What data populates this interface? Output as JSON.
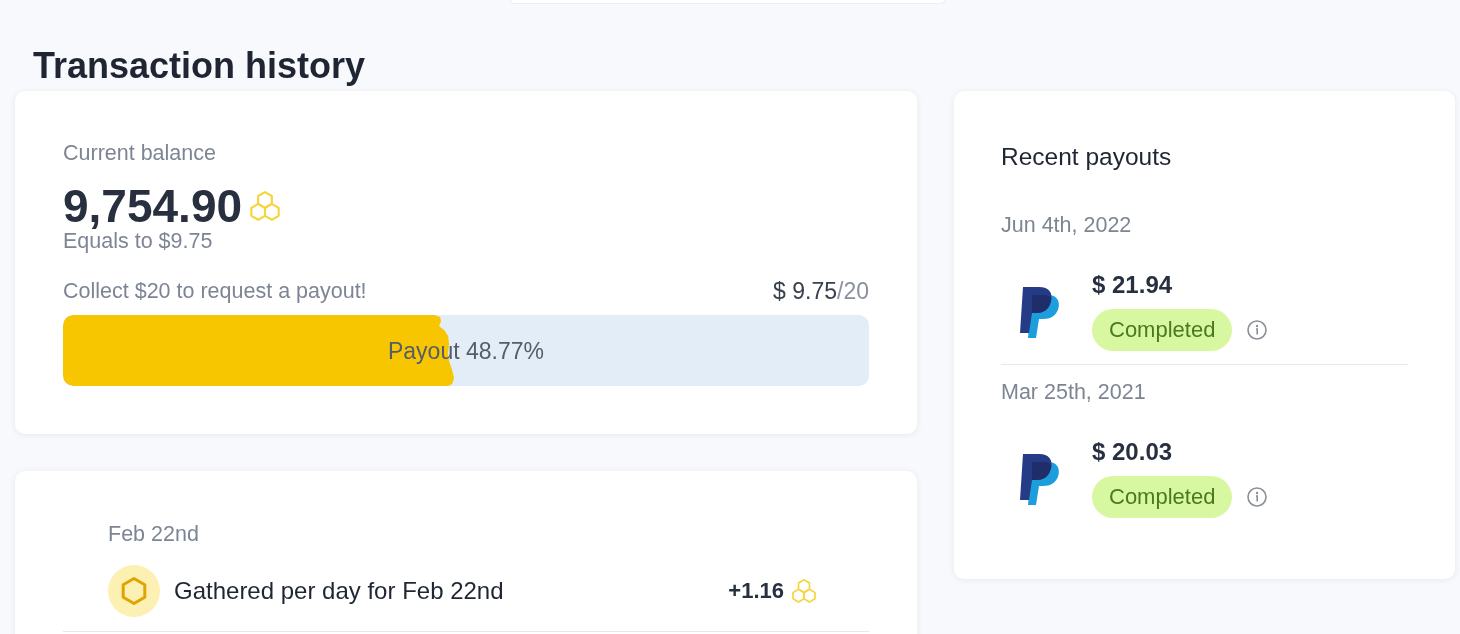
{
  "header": {
    "title": "Transaction history"
  },
  "balance_card": {
    "label": "Current balance",
    "amount": "9,754.90",
    "equivalent": "Equals to $9.75",
    "goal_text": "Collect $20 to request a payout!",
    "progress_current": "$ 9.75",
    "progress_target": "/20",
    "progress": {
      "level": 0.4877,
      "label": "Payout 48.77%"
    }
  },
  "activity": [
    {
      "date": "Feb 22nd",
      "entries": [
        {
          "description": "Gathered per day for Feb 22nd",
          "amount": "+1.16"
        }
      ]
    }
  ],
  "payouts": {
    "title": "Recent payouts",
    "items": [
      {
        "date": "Jun 4th, 2022",
        "amount": "$ 21.94",
        "status": "Completed"
      },
      {
        "date": "Mar 25th, 2021",
        "amount": "$ 20.03",
        "status": "Completed"
      }
    ]
  }
}
